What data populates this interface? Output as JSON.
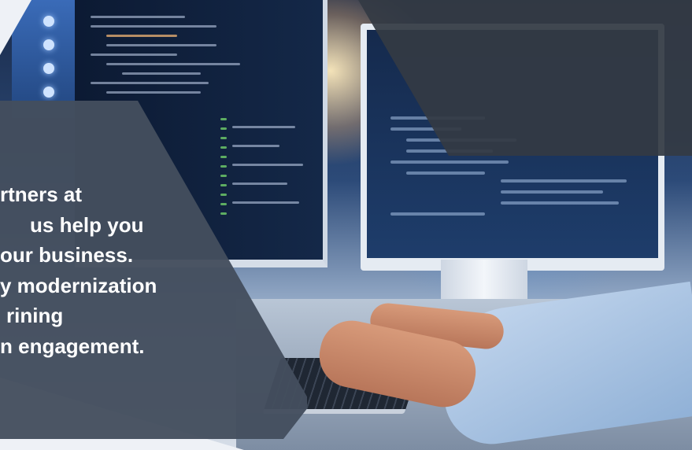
{
  "blurb": {
    "lines": [
      "rtners at",
      "us help you",
      "our business.",
      "y modernization",
      "rining",
      "n engagement."
    ]
  },
  "colors": {
    "panel": "#444e5e",
    "overlay": "#343a44",
    "text": "#ffffff"
  }
}
